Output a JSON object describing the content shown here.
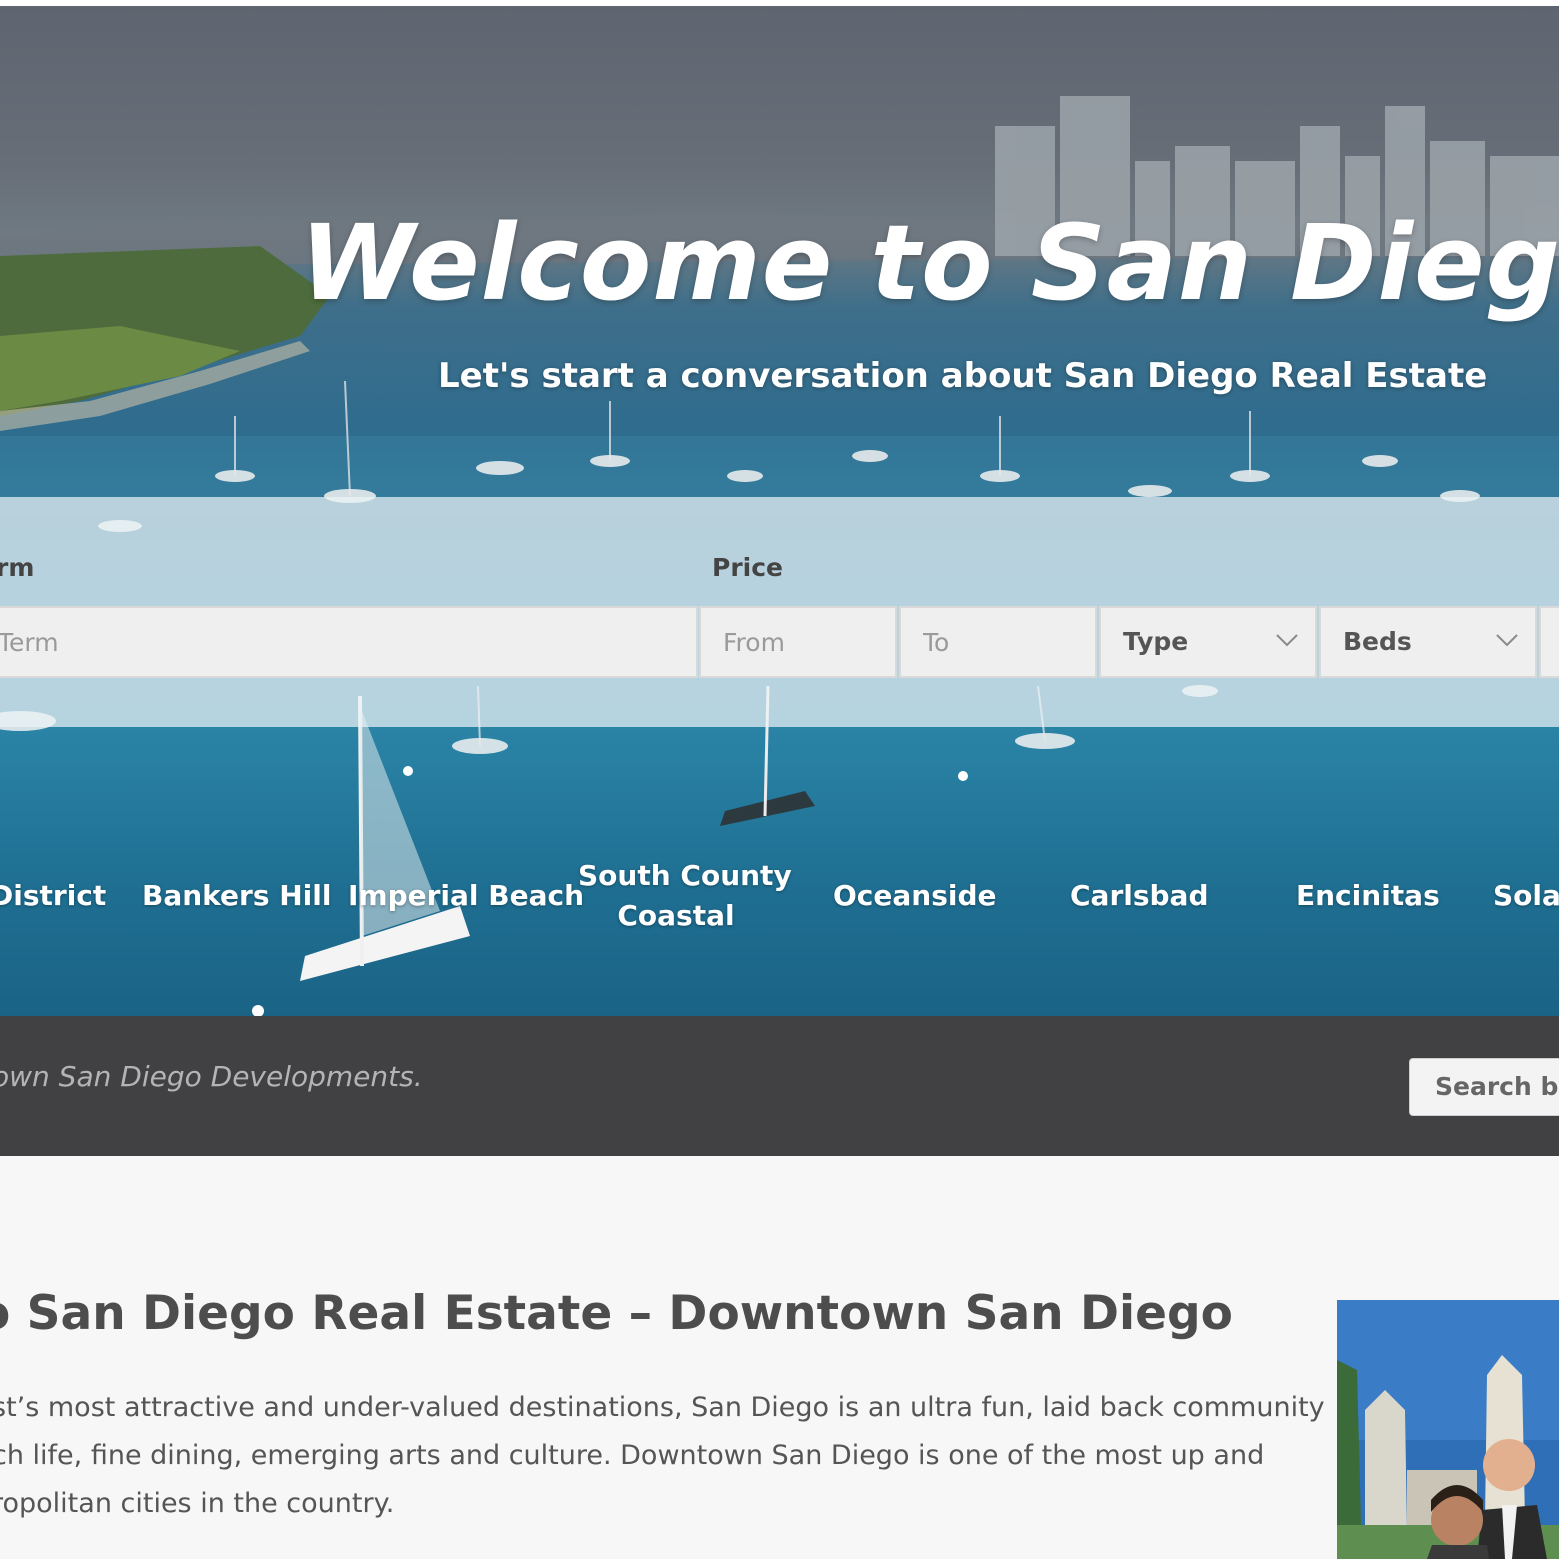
{
  "hero": {
    "title": "Welcome to San Diego",
    "subtitle": "Let's start a conversation about San Diego Real Estate"
  },
  "search": {
    "term_label": "rm",
    "price_label": "Price",
    "term_placeholder": "Term",
    "from_placeholder": "From",
    "to_placeholder": "To",
    "type_value": "Type",
    "beds_value": "Beds"
  },
  "neighborhoods": {
    "items": [
      {
        "label": "District"
      },
      {
        "label": "Bankers Hill"
      },
      {
        "label": "Imperial Beach"
      },
      {
        "label_line1": "South County",
        "label_line2": "Coastal"
      },
      {
        "label": "Oceanside"
      },
      {
        "label": "Carlsbad"
      },
      {
        "label": "Encinitas"
      },
      {
        "label": "Solar"
      }
    ]
  },
  "dark_bar": {
    "text": "own San Diego Developments.",
    "button_label": "Search by"
  },
  "content": {
    "title": "o San Diego Real Estate – Downtown San Diego",
    "paragraph_lines": [
      "st’s most attractive and under-valued destinations, San Diego is an ultra fun, laid back community",
      "ch life, fine dining, emerging arts and culture. Downtown San Diego is one of the most up and",
      "ropolitan cities in the country."
    ]
  },
  "colors": {
    "dark_bar": "#414143",
    "page_bg": "#f7f7f7",
    "title_text": "#4d4d4d"
  },
  "icons": [
    "chevron-down-icon"
  ]
}
